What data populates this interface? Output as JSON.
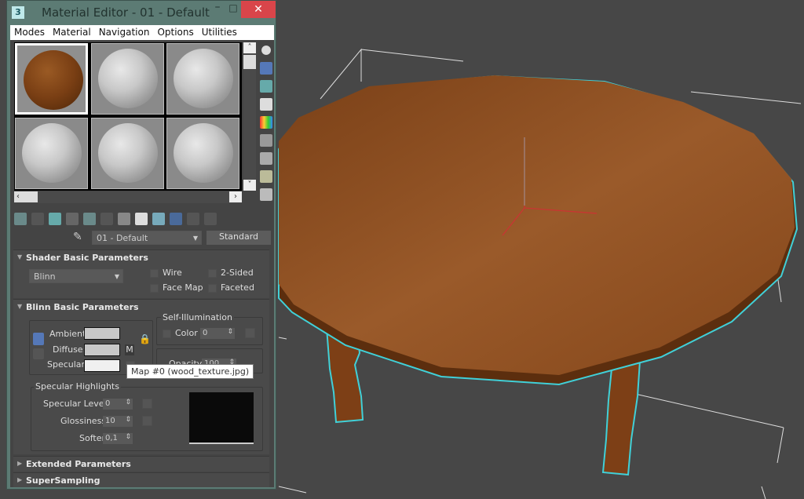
{
  "window": {
    "title": "Material Editor - 01 - Default",
    "app_icon": "3",
    "close": "✕",
    "minimize": "–",
    "maximize": "□"
  },
  "menu": [
    "Modes",
    "Material",
    "Navigation",
    "Options",
    "Utilities"
  ],
  "material": {
    "name": "01 - Default",
    "type": "Standard"
  },
  "shader_rollout": {
    "title": "Shader Basic Parameters",
    "shader": "Blinn",
    "wire": "Wire",
    "two_sided": "2-Sided",
    "face_map": "Face Map",
    "faceted": "Faceted"
  },
  "blinn_rollout": {
    "title": "Blinn Basic Parameters",
    "ambient": "Ambient:",
    "diffuse": "Diffuse:",
    "specular": "Specular:",
    "map_btn": "M",
    "self_illum": "Self-Illumination",
    "color": "Color",
    "color_value": "0",
    "opacity": "Opacity:",
    "opacity_value": "100",
    "spec_highlights": "Specular Highlights",
    "spec_level": "Specular Level:",
    "spec_level_value": "0",
    "glossiness": "Glossiness:",
    "glossiness_value": "10",
    "soften": "Soften:",
    "soften_value": "0,1"
  },
  "tooltip": "Map #0 (wood_texture.jpg)",
  "collapsed_rollouts": [
    "Extended Parameters",
    "SuperSampling"
  ],
  "colors": {
    "wood": "#8b4a1c",
    "selection": "#40d0d8",
    "viewport_bg": "#474747",
    "close": "#d9454a"
  }
}
